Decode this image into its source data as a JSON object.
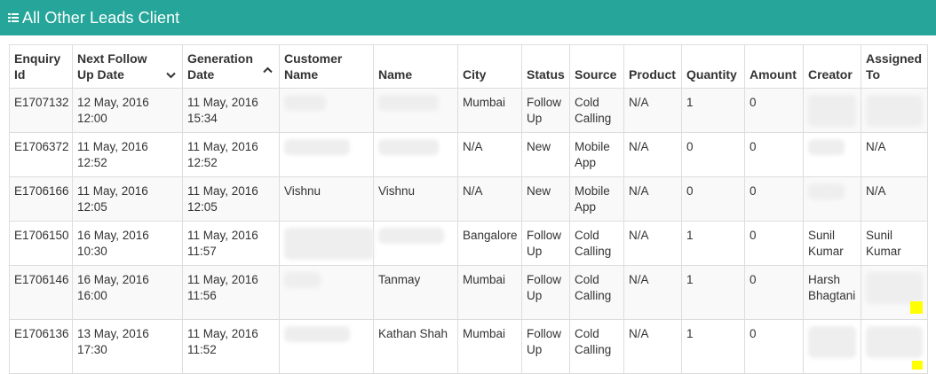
{
  "header": {
    "title": "All Other Leads Client",
    "icon": "table-icon",
    "background": "#26a69a"
  },
  "table": {
    "columns": [
      "Enquiry Id",
      "Next Follow Up Date",
      "Generation Date",
      "Customer Name",
      "Name",
      "City",
      "Status",
      "Source",
      "Product",
      "Quantity",
      "Amount",
      "Creator",
      "Assigned To"
    ],
    "rows": [
      {
        "enquiry_id": "E1707132",
        "next_follow_up": "12 May, 2016 12:00",
        "generation": "11 May, 2016 15:34",
        "customer_name": "",
        "name": "",
        "city": "Mumbai",
        "status": "Follow Up",
        "source": "Cold Calling",
        "product": "N/A",
        "quantity": "1",
        "amount": "0",
        "creator": "",
        "assigned_to": ""
      },
      {
        "enquiry_id": "E1706372",
        "next_follow_up": "11 May, 2016 12:52",
        "generation": "11 May, 2016 12:52",
        "customer_name": "",
        "name": "",
        "city": "N/A",
        "status": "New",
        "source": "Mobile App",
        "product": "N/A",
        "quantity": "0",
        "amount": "0",
        "creator": "",
        "assigned_to": "N/A"
      },
      {
        "enquiry_id": "E1706166",
        "next_follow_up": "11 May, 2016 12:05",
        "generation": "11 May, 2016 12:05",
        "customer_name": "Vishnu",
        "name": "Vishnu",
        "city": "N/A",
        "status": "New",
        "source": "Mobile App",
        "product": "N/A",
        "quantity": "0",
        "amount": "0",
        "creator": "",
        "assigned_to": "N/A"
      },
      {
        "enquiry_id": "E1706150",
        "next_follow_up": "16 May, 2016 10:30",
        "generation": "11 May, 2016 11:57",
        "customer_name": "",
        "name": "",
        "city": "Bangalore",
        "status": "Follow Up",
        "source": "Cold Calling",
        "product": "N/A",
        "quantity": "1",
        "amount": "0",
        "creator": "Sunil Kumar",
        "assigned_to": "Sunil Kumar"
      },
      {
        "enquiry_id": "E1706146",
        "next_follow_up": "16 May, 2016 16:00",
        "generation": "11 May, 2016 11:56",
        "customer_name": "",
        "name": "Tanmay",
        "city": "Mumbai",
        "status": "Follow Up",
        "source": "Cold Calling",
        "product": "N/A",
        "quantity": "1",
        "amount": "0",
        "creator": "Harsh Bhagtani",
        "assigned_to": ""
      },
      {
        "enquiry_id": "E1706136",
        "next_follow_up": "13 May, 2016 17:30",
        "generation": "11 May, 2016 11:52",
        "customer_name": "",
        "name": "Kathan Shah",
        "city": "Mumbai",
        "status": "Follow Up",
        "source": "Cold Calling",
        "product": "N/A",
        "quantity": "1",
        "amount": "0",
        "creator": "",
        "assigned_to": ""
      }
    ]
  }
}
